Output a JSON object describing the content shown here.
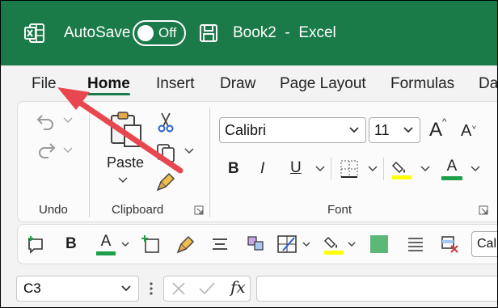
{
  "titlebar": {
    "autosave_label": "AutoSave",
    "autosave_state": "Off",
    "book_title": "Book2  -  Excel",
    "color": "#1a7b48"
  },
  "tabs": [
    {
      "label": "File"
    },
    {
      "label": "Home",
      "active": true
    },
    {
      "label": "Insert"
    },
    {
      "label": "Draw"
    },
    {
      "label": "Page Layout"
    },
    {
      "label": "Formulas"
    },
    {
      "label": "Da"
    }
  ],
  "ribbon": {
    "groups": {
      "undo": "Undo",
      "clipboard": "Clipboard",
      "font": "Font"
    },
    "paste_label": "Paste",
    "font_name": "Calibri",
    "font_size": "11",
    "bold": "B",
    "italic": "I",
    "underline": "U",
    "grow_font": "A",
    "shrink_font": "A",
    "font_color_letter": "A"
  },
  "qat": {
    "bold": "B",
    "font_color_letter": "A",
    "partial_font": "Cal"
  },
  "formula_bar": {
    "namebox_value": "C3",
    "fx_label": "fx",
    "formula_value": ""
  },
  "colors": {
    "accent_green": "#1a7b48",
    "highlight_yellow": "#ffff00",
    "font_color_green": "#1ea04a",
    "annotation_red": "#e8474f"
  },
  "icons": [
    "excel-logo-icon",
    "save-icon",
    "undo-icon",
    "redo-icon",
    "paste-icon",
    "cut-icon",
    "copy-icon",
    "format-painter-icon",
    "borders-icon",
    "fill-color-icon",
    "font-color-icon",
    "dialog-launcher-icon",
    "close-icon",
    "check-icon"
  ]
}
